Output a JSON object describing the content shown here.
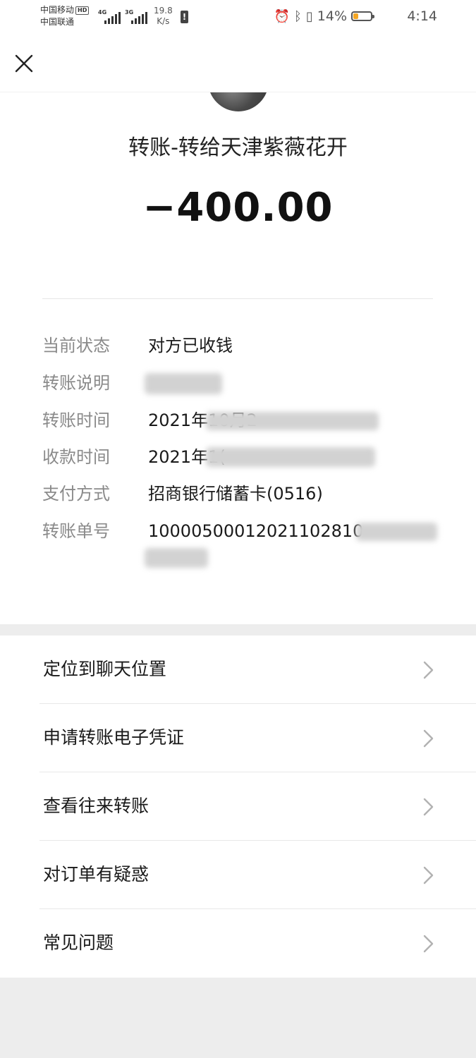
{
  "status_bar": {
    "carrier_1": "中国移动",
    "hd_badge": "HD",
    "carrier_2": "中国联通",
    "net_1": "4G",
    "net_2": "3G",
    "speed_value": "19.8",
    "speed_unit": "K/s",
    "battery_percent": "14%",
    "battery_level": 0.14,
    "time": "4:14"
  },
  "nav": {
    "close_icon": "close-icon"
  },
  "transfer": {
    "title": "转账-转给天津紫薇花开",
    "amount": "−400.00"
  },
  "details": [
    {
      "label": "当前状态",
      "value": "对方已收钱"
    },
    {
      "label": "转账说明",
      "value": ""
    },
    {
      "label": "转账时间",
      "value": "2021年10月2"
    },
    {
      "label": "收款时间",
      "value": "2021年1("
    },
    {
      "label": "支付方式",
      "value": "招商银行储蓄卡(0516)"
    },
    {
      "label": "转账单号",
      "value": "10000500012021102810"
    }
  ],
  "menu": [
    {
      "label": "定位到聊天位置"
    },
    {
      "label": "申请转账电子凭证"
    },
    {
      "label": "查看往来转账"
    },
    {
      "label": "对订单有疑惑"
    },
    {
      "label": "常见问题"
    }
  ],
  "colors": {
    "background": "#ededed",
    "battery_low": "#f5a623",
    "label_gray": "#8a8a8a"
  }
}
